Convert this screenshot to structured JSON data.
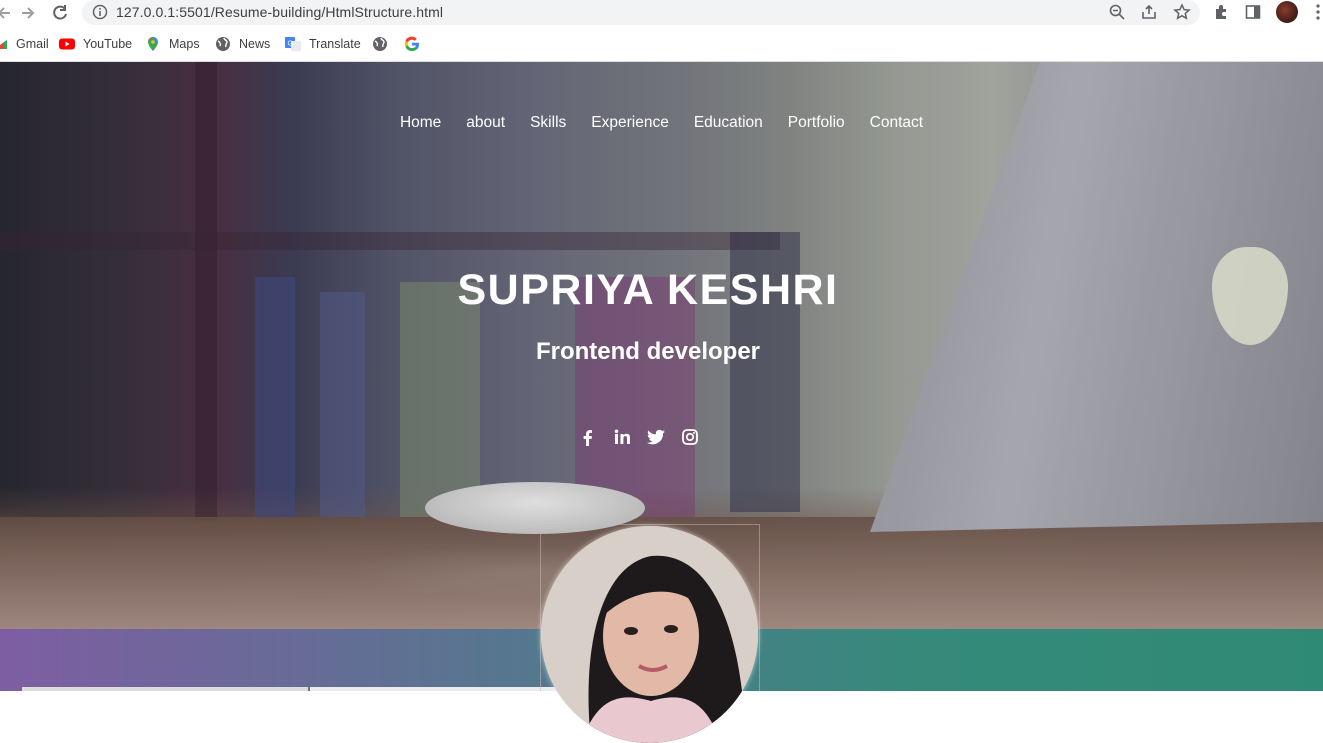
{
  "browser": {
    "url": "127.0.0.1:5501/Resume-building/HtmlStructure.html",
    "bookmarks": [
      {
        "label": "Gmail",
        "icon": "gmail-icon"
      },
      {
        "label": "YouTube",
        "icon": "youtube-icon"
      },
      {
        "label": "Maps",
        "icon": "maps-icon"
      },
      {
        "label": "News",
        "icon": "globe-icon"
      },
      {
        "label": "Translate",
        "icon": "translate-icon"
      },
      {
        "label": "",
        "icon": "globe-icon"
      },
      {
        "label": "",
        "icon": "google-icon"
      }
    ]
  },
  "nav": {
    "items": [
      "Home",
      "about",
      "Skills",
      "Experience",
      "Education",
      "Portfolio",
      "Contact"
    ]
  },
  "hero": {
    "name": "SUPRIYA KESHRI",
    "role": "Frontend developer",
    "social": [
      "facebook-icon",
      "linkedin-icon",
      "twitter-icon",
      "instagram-icon"
    ]
  },
  "colors": {
    "band_start": "#7e5ea3",
    "band_end": "#2f8a74",
    "hero_text": "#ffffff"
  }
}
